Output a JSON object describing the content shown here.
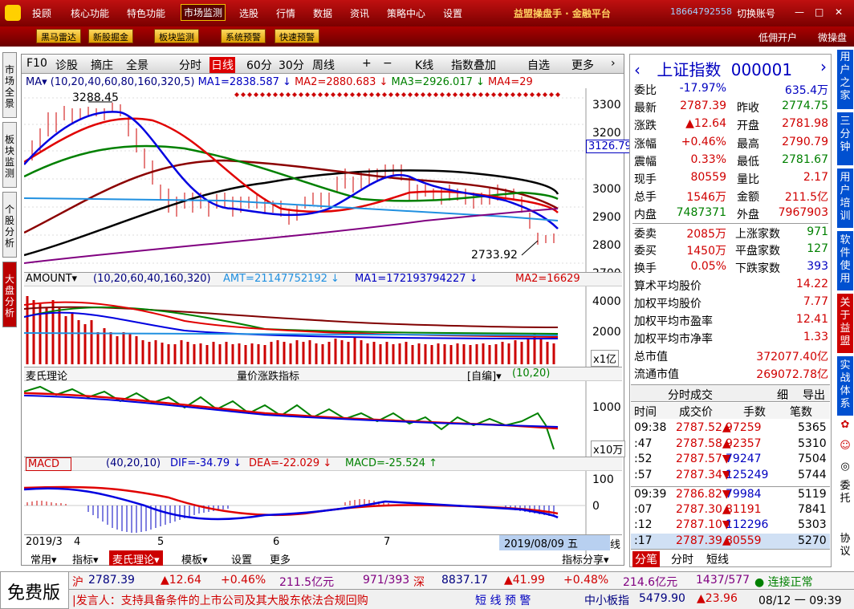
{
  "menu": {
    "items": [
      "投顾",
      "核心功能",
      "特色功能",
      "市场监测",
      "选股",
      "行情",
      "数据",
      "资讯",
      "策略中心",
      "设置"
    ],
    "title": "益盟操盘手 · 金融平台",
    "phone": "18664792558",
    "switch_account": "切换账号"
  },
  "toolbar": {
    "buttons": [
      "黑马雷达",
      "新股掘金",
      "板块监测",
      "系统预警",
      "快速预警"
    ],
    "right": [
      "低佣开户",
      "微操盘"
    ]
  },
  "left_tabs": [
    "市场全景",
    "板块监测",
    "个股分析",
    "大盘分析"
  ],
  "chart_toolbar": {
    "items": [
      "F10",
      "诊股",
      "摘庄",
      "全景",
      "分时",
      "日线",
      "60分",
      "30分",
      "周线",
      "+",
      "−",
      "K线",
      "指数叠加",
      "自选",
      "更多"
    ]
  },
  "kline": {
    "ma_legend": "MA▾ (10,20,40,60,80,160,320,5)",
    "ma1": "MA1=2838.587 ↓",
    "ma2": "MA2=2880.683 ↓",
    "ma3": "MA3=2926.017 ↓",
    "ma4": "MA4=29",
    "high_label": "3288.45",
    "low_label": "2733.92",
    "price_tag": "3126.79",
    "yticks": [
      "3300",
      "3200",
      "3100",
      "3000",
      "2900",
      "2800",
      "2700"
    ]
  },
  "amount": {
    "title": "AMOUNT▾",
    "params": "(10,20,60,40,160,320)",
    "amt": "AMT=21147752192 ↓",
    "ma1": "MA1=172193794227 ↓",
    "ma2": "MA2=16629",
    "yticks": [
      "4000",
      "2000"
    ],
    "unit": "x1亿"
  },
  "mai": {
    "title": "麦氏理论",
    "center": "量价涨跌指标",
    "mode": "[自编]▾",
    "params": "(10,20)",
    "ytick": "1000",
    "unit": "x10万"
  },
  "macd": {
    "title": "MACD",
    "params": "(40,20,10)",
    "dif": "DIF=-34.79 ↓",
    "dea": "DEA=-22.029 ↓",
    "macd": "MACD=-25.524 ↑",
    "yticks": [
      "100",
      "0"
    ]
  },
  "date_axis": {
    "labels": [
      "2019/3",
      "4",
      "5",
      "6",
      "7"
    ],
    "current": "2019/08/09 五",
    "right": "线"
  },
  "bottom_tabs": [
    "常用▾",
    "指标▾",
    "麦氏理论▾",
    "模板▾",
    "设置",
    "更多"
  ],
  "indicator_share": "指标分享▾",
  "quote": {
    "name": "上证指数",
    "code": "000001",
    "rows": [
      [
        "委比",
        "-17.97%",
        "",
        "635.4万"
      ],
      [
        "最新",
        "2787.39",
        "昨收",
        "2774.75"
      ],
      [
        "涨跌",
        "▲12.64",
        "开盘",
        "2781.98"
      ],
      [
        "涨幅",
        "+0.46%",
        "最高",
        "2790.79"
      ],
      [
        "震幅",
        "0.33%",
        "最低",
        "2781.67"
      ],
      [
        "现手",
        "80559",
        "量比",
        "2.17"
      ],
      [
        "总手",
        "1546万",
        "金额",
        "211.5亿"
      ],
      [
        "内盘",
        "7487371",
        "外盘",
        "7967903"
      ],
      [
        "委卖",
        "2085万",
        "上涨家数",
        "971"
      ],
      [
        "委买",
        "1450万",
        "平盘家数",
        "127"
      ],
      [
        "换手",
        "0.05%",
        "下跌家数",
        "393"
      ]
    ],
    "stats": [
      [
        "算术平均股价",
        "14.22"
      ],
      [
        "加权平均股价",
        "7.77"
      ],
      [
        "加权平均市盈率",
        "12.41"
      ],
      [
        "加权平均市净率",
        "1.33"
      ],
      [
        "总市值",
        "372077.40亿"
      ],
      [
        "流通市值",
        "269072.78亿"
      ]
    ],
    "ticks_title": "分时成交",
    "ticks_btns": [
      "细",
      "导出"
    ],
    "ticks_header": [
      "时间",
      "成交价",
      "手数",
      "笔数"
    ],
    "ticks": [
      [
        "09:38",
        "2787.52▲",
        "97259",
        "5365"
      ],
      [
        ":47",
        "2787.58▲",
        "92357",
        "5310"
      ],
      [
        ":52",
        "2787.57▼",
        "79247",
        "7504"
      ],
      [
        ":57",
        "2787.34▼",
        "125249",
        "5744"
      ],
      [
        "09:39",
        "2786.82▼",
        "79984",
        "5119"
      ],
      [
        ":07",
        "2787.30▲",
        "81191",
        "7841"
      ],
      [
        ":12",
        "2787.10▼",
        "112296",
        "5303"
      ],
      [
        ":17",
        "2787.39▲",
        "80559",
        "5270"
      ]
    ],
    "bottom_tabs": [
      "分笔",
      "分时",
      "短线"
    ]
  },
  "right_tabs": [
    "用户之家",
    "三分钟",
    "用户培训",
    "软件使用",
    "关于益盟",
    "实战体系",
    "委托",
    "协议"
  ],
  "status": {
    "free": "免费版",
    "sh": "沪",
    "sh_price": "2787.39",
    "sh_chg": "▲12.64",
    "sh_pct": "+0.46%",
    "sh_amt": "211.5亿元",
    "sh_ud": "971/393",
    "sz": "深",
    "sz_price": "8837.17",
    "sz_chg": "▲41.99",
    "sz_pct": "+0.48%",
    "sz_amt": "214.6亿元",
    "sz_ud": "1437/577",
    "conn": "连接正常",
    "ticker": "|发言人：支持具备条件的上市公司及其大股东依法合规回购",
    "short": "短 线 预 警",
    "smb": "中小板指",
    "smb_price": "5479.90",
    "smb_chg": "▲23.96",
    "date": "08/12 一 09:39"
  },
  "colors": {
    "red": "#d00000",
    "green": "#008000",
    "blue": "#0000c0",
    "brand": "#b00000"
  }
}
